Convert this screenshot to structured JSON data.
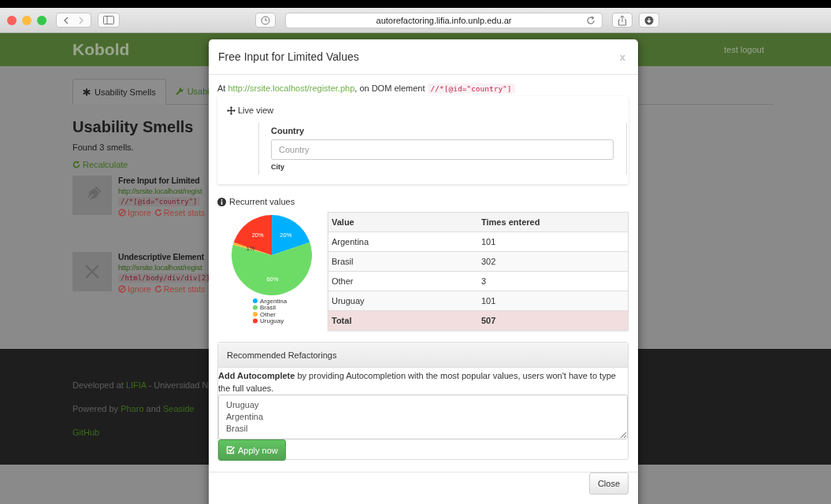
{
  "browser": {
    "url": "autorefactoring.lifia.info.unlp.edu.ar"
  },
  "navbar": {
    "brand": "Kobold",
    "user_menu": "test logout"
  },
  "tabs": [
    {
      "label": "Usability Smells",
      "selected": true
    },
    {
      "label": "Usabi",
      "selected": false
    }
  ],
  "page": {
    "heading": "Usability Smells",
    "summary": "Found 3 smells.",
    "recalculate": "Recalculate"
  },
  "smells": [
    {
      "title": "Free Input for Limited",
      "url": "http://srsite.localhost/regist",
      "xpath": "//*[@id=\"country\"]",
      "actions": [
        "Ignore",
        "Reset stats"
      ]
    },
    {
      "title": "Undescriptive Element",
      "url": "http://srsite.localhost/regist",
      "xpath": "/html/body/div/div[2]",
      "actions": [
        "Ignore",
        "Reset stats"
      ]
    }
  ],
  "footer": {
    "developed_prefix": "Developed at ",
    "developed_link": "LIFIA",
    "developed_suffix": " - Universidad N",
    "powered_prefix": "Powered by ",
    "powered_link_1": "Pharo",
    "powered_middle": " and ",
    "powered_link_2": "Seaside",
    "github": "GitHub"
  },
  "modal": {
    "title": "Free Input for Limited Values",
    "close_mark": "x",
    "location": {
      "prefix": "At ",
      "url": "http://srsite.localhost/register.php",
      "middle": ", on DOM element ",
      "xpath": "//*[@id=\"country\"]"
    },
    "live_view": {
      "title": "Live view",
      "field_label": "Country",
      "field_placeholder": "Country",
      "next_label": "City"
    },
    "recurrent": {
      "title": "Recurrent values",
      "chart_data": {
        "type": "pie",
        "categories": [
          "Argentina",
          "Brasil",
          "Other",
          "Uruguay"
        ],
        "values": [
          20,
          60,
          1,
          20
        ],
        "legend": "bottom",
        "colors": [
          "#00b0ff",
          "#6ddc66",
          "#ffb83a",
          "#ff3a24"
        ],
        "value_labels": [
          "20%",
          "60%",
          "1%",
          "20%"
        ]
      },
      "table": {
        "columns": [
          "Value",
          "Times entered"
        ],
        "rows": [
          [
            "Argentina",
            "101"
          ],
          [
            "Brasil",
            "302"
          ],
          [
            "Other",
            "3"
          ],
          [
            "Uruguay",
            "101"
          ]
        ],
        "total": [
          "Total",
          "507"
        ]
      }
    },
    "refactorings": {
      "title": "Recommended Refactorings",
      "description": "**Add Autocomplete** by providing Autocompletion with the most popular values, users won't have to type the full values.",
      "values": "Uruguay\nArgentina\nBrasil",
      "apply": "Apply now"
    },
    "close": "Close"
  }
}
